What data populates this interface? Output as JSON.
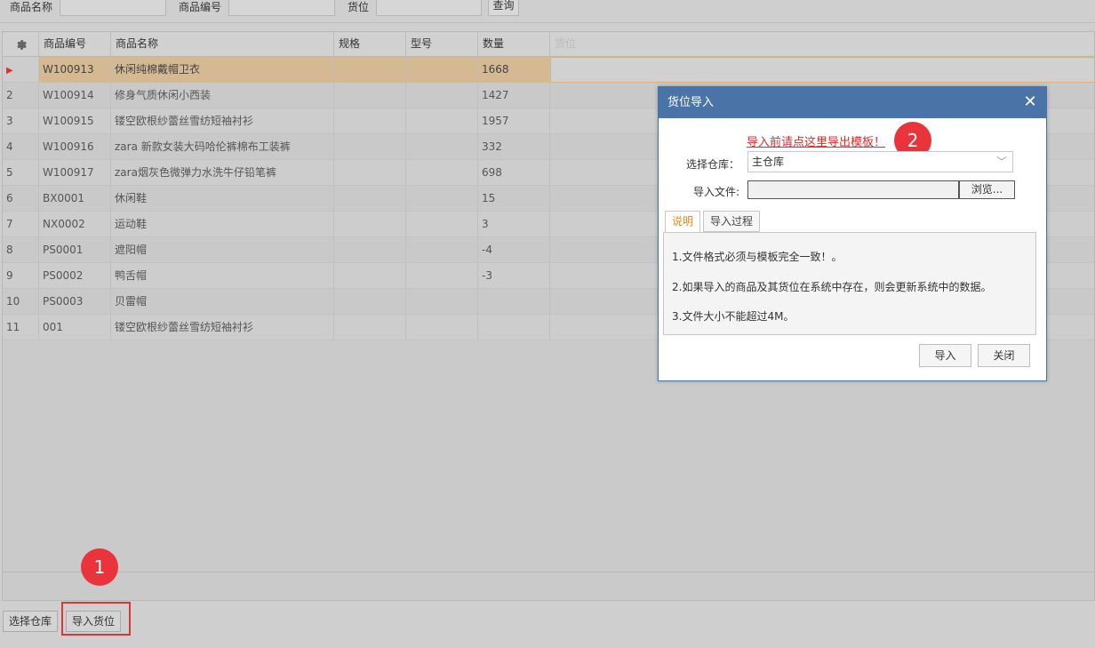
{
  "filters": {
    "product_name_label": "商品名称",
    "product_code_label": "商品编号",
    "location_label": "货位",
    "search_button": "查询"
  },
  "grid": {
    "columns": [
      "商品编号",
      "商品名称",
      "规格",
      "型号",
      "数量",
      "货位"
    ],
    "rows": [
      {
        "no": "",
        "code": "W100913",
        "name": "休闲纯棉戴帽卫衣",
        "spec": "",
        "model": "",
        "qty": "1668"
      },
      {
        "no": "2",
        "code": "W100914",
        "name": "修身气质休闲小西装",
        "spec": "",
        "model": "",
        "qty": "1427"
      },
      {
        "no": "3",
        "code": "W100915",
        "name": "镂空欧根纱蕾丝雪纺短袖衬衫",
        "spec": "",
        "model": "",
        "qty": "1957"
      },
      {
        "no": "4",
        "code": "W100916",
        "name": "zara 新款女装大码哈伦裤棉布工装裤",
        "spec": "",
        "model": "",
        "qty": "332"
      },
      {
        "no": "5",
        "code": "W100917",
        "name": "zara烟灰色微弹力水洗牛仔铅笔裤",
        "spec": "",
        "model": "",
        "qty": "698"
      },
      {
        "no": "6",
        "code": "BX0001",
        "name": "休闲鞋",
        "spec": "",
        "model": "",
        "qty": "15"
      },
      {
        "no": "7",
        "code": "NX0002",
        "name": "运动鞋",
        "spec": "",
        "model": "",
        "qty": "3"
      },
      {
        "no": "8",
        "code": "PS0001",
        "name": "遮阳帽",
        "spec": "",
        "model": "",
        "qty": "-4"
      },
      {
        "no": "9",
        "code": "PS0002",
        "name": "鸭舌帽",
        "spec": "",
        "model": "",
        "qty": "-3"
      },
      {
        "no": "10",
        "code": "PS0003",
        "name": "贝雷帽",
        "spec": "",
        "model": "",
        "qty": ""
      },
      {
        "no": "11",
        "code": "001",
        "name": "镂空欧根纱蕾丝雪纺短袖衬衫",
        "spec": "",
        "model": "",
        "qty": ""
      }
    ]
  },
  "toolbar": {
    "select_warehouse": "选择仓库",
    "import_location": "导入货位"
  },
  "annotations": {
    "badge1": "1",
    "badge2": "2"
  },
  "dialog": {
    "title": "货位导入",
    "template_link": "导入前请点这里导出模板！",
    "warehouse_label": "选择仓库：",
    "warehouse_value": "主仓库",
    "file_label": "导入文件:",
    "browse_button": "浏览...",
    "tabs": [
      "说明",
      "导入过程"
    ],
    "notes": [
      "1.文件格式必须与模板完全一致！。",
      "2.如果导入的商品及其货位在系统中存在，则会更新系统中的数据。",
      "3.文件大小不能超过4M。"
    ],
    "import_button": "导入",
    "close_button": "关闭"
  },
  "colors": {
    "dialog_header": "#4a74a8",
    "link_red": "#e02a2a",
    "badge_red": "#e8343a",
    "selected_row": "#d4b992",
    "active_tab": "#e08a1e"
  }
}
